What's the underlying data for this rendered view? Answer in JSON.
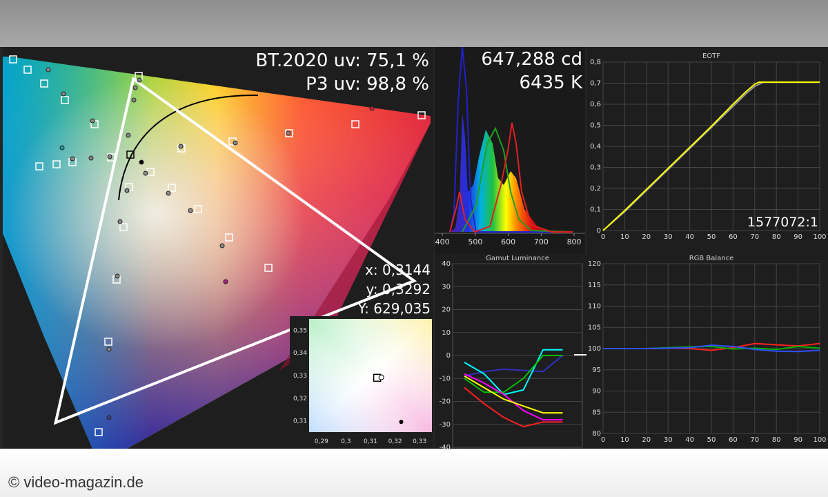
{
  "credit": "© video-magazin.de",
  "colors": {
    "background": "#262626",
    "panel": "#1e1e1e",
    "accent_white": "#ffffff"
  },
  "readouts": {
    "bt2020": "BT.2020 uv: 75,1 %",
    "p3": "P3 uv: 98,8 %",
    "luminance": "647,288 cd",
    "cct": "6435 K",
    "x": "x: 0,3144",
    "y": "y: 0,3292",
    "Y": "Y: 629,035",
    "contrast": "1577072:1"
  },
  "chart_data": [
    {
      "type": "scatter",
      "chart": "cie-gamut",
      "gamut_primaries": {
        "red": [
          0.68,
          0.32
        ],
        "green": [
          0.265,
          0.69
        ],
        "blue": [
          0.15,
          0.06
        ]
      },
      "white_point": [
        0.3144,
        0.3292
      ]
    },
    {
      "type": "line",
      "chart": "spectrum",
      "xticks": [
        "400",
        "500",
        "600",
        "700",
        "800"
      ],
      "xlim": [
        385,
        825
      ]
    },
    {
      "type": "line",
      "chart": "eotf",
      "title": "EOTF",
      "xticks": [
        "0",
        "10",
        "20",
        "30",
        "40",
        "50",
        "60",
        "70",
        "80",
        "90",
        "100"
      ],
      "yticks": [
        "0",
        "0,1",
        "0,2",
        "0,3",
        "0,4",
        "0,5",
        "0,6",
        "0,7",
        "0,8"
      ],
      "xlim": [
        0,
        100
      ],
      "ylim": [
        0,
        0.8
      ],
      "series": [
        {
          "color": "#999999",
          "x": [
            0,
            10,
            20,
            30,
            40,
            50,
            60,
            66,
            70,
            74,
            80,
            100
          ],
          "y": [
            0,
            0.09,
            0.19,
            0.29,
            0.39,
            0.49,
            0.59,
            0.65,
            0.685,
            0.705,
            0.705,
            0.705
          ]
        },
        {
          "color": "#ffff00",
          "x": [
            0,
            10,
            20,
            30,
            40,
            50,
            60,
            66,
            70,
            72,
            80,
            100
          ],
          "y": [
            0,
            0.095,
            0.195,
            0.295,
            0.395,
            0.495,
            0.6,
            0.66,
            0.695,
            0.705,
            0.705,
            0.705
          ]
        }
      ]
    },
    {
      "type": "line",
      "chart": "gamut-luminance",
      "title": "Gamut Luminance",
      "yticks": [
        "40",
        "30",
        "20",
        "10",
        "0",
        "-10",
        "-20",
        "-30",
        "-40"
      ],
      "ylim": [
        -40,
        40
      ],
      "series": [
        {
          "color": "#3030c0",
          "x": [
            0,
            1,
            2,
            3,
            4,
            5
          ],
          "y": [
            -9,
            -7,
            -6,
            -6.5,
            -7,
            0
          ]
        },
        {
          "color": "#00ffff",
          "x": [
            0,
            1,
            2,
            3,
            4,
            5
          ],
          "y": [
            -3,
            -8,
            -17,
            -15,
            2.5,
            2.5
          ]
        },
        {
          "color": "#00c000",
          "x": [
            0,
            1,
            2,
            3,
            4,
            5
          ],
          "y": [
            -10,
            -16,
            -16,
            -10,
            0,
            0
          ]
        },
        {
          "color": "#ff00ff",
          "x": [
            0,
            1,
            2,
            3,
            4,
            5
          ],
          "y": [
            -8,
            -12,
            -17,
            -24,
            -28,
            -28
          ]
        },
        {
          "color": "#ffff00",
          "x": [
            0,
            1,
            2,
            3,
            4,
            5
          ],
          "y": [
            -9,
            -14,
            -19,
            -22,
            -25,
            -25
          ]
        },
        {
          "color": "#ff2020",
          "x": [
            0,
            1,
            2,
            3,
            4,
            5
          ],
          "y": [
            -14,
            -21,
            -27,
            -31,
            -29,
            -29
          ]
        }
      ]
    },
    {
      "type": "line",
      "chart": "rgb-balance",
      "title": "RGB Balance",
      "xticks": [
        "0",
        "10",
        "20",
        "30",
        "40",
        "50",
        "60",
        "70",
        "80",
        "90",
        "100"
      ],
      "yticks": [
        "80",
        "85",
        "90",
        "95",
        "100",
        "105",
        "110",
        "115",
        "120"
      ],
      "xlim": [
        0,
        100
      ],
      "ylim": [
        80,
        120
      ],
      "series": [
        {
          "color": "#ff2020",
          "x": [
            0,
            10,
            20,
            30,
            40,
            50,
            60,
            70,
            80,
            90,
            100
          ],
          "y": [
            100,
            100,
            100,
            100.1,
            100,
            99.6,
            100.2,
            101.2,
            100.9,
            100.6,
            101.2
          ]
        },
        {
          "color": "#00b000",
          "x": [
            0,
            10,
            20,
            30,
            40,
            50,
            60,
            70,
            80,
            90,
            100
          ],
          "y": [
            100,
            100,
            100,
            100.2,
            100.4,
            100.5,
            99.9,
            100.1,
            99.8,
            100.5,
            100.1
          ]
        },
        {
          "color": "#3050ff",
          "x": [
            0,
            10,
            20,
            30,
            40,
            50,
            60,
            70,
            80,
            90,
            100
          ],
          "y": [
            100,
            100,
            100,
            100.1,
            100.2,
            100.8,
            100.5,
            99.8,
            99.4,
            99.3,
            99.6
          ]
        }
      ]
    },
    {
      "type": "scatter",
      "chart": "white-point-zoom",
      "xticks": [
        "0,29",
        "0,3",
        "0,31",
        "0,32",
        "0,33"
      ],
      "yticks": [
        "0,35",
        "0,34",
        "0,33",
        "0,32",
        "0,31"
      ],
      "xlim": [
        0.285,
        0.335
      ],
      "ylim": [
        0.305,
        0.355
      ],
      "target": [
        0.3127,
        0.329
      ],
      "measured": [
        0.3144,
        0.3292
      ],
      "extra_point": [
        0.3225,
        0.3095
      ]
    }
  ]
}
